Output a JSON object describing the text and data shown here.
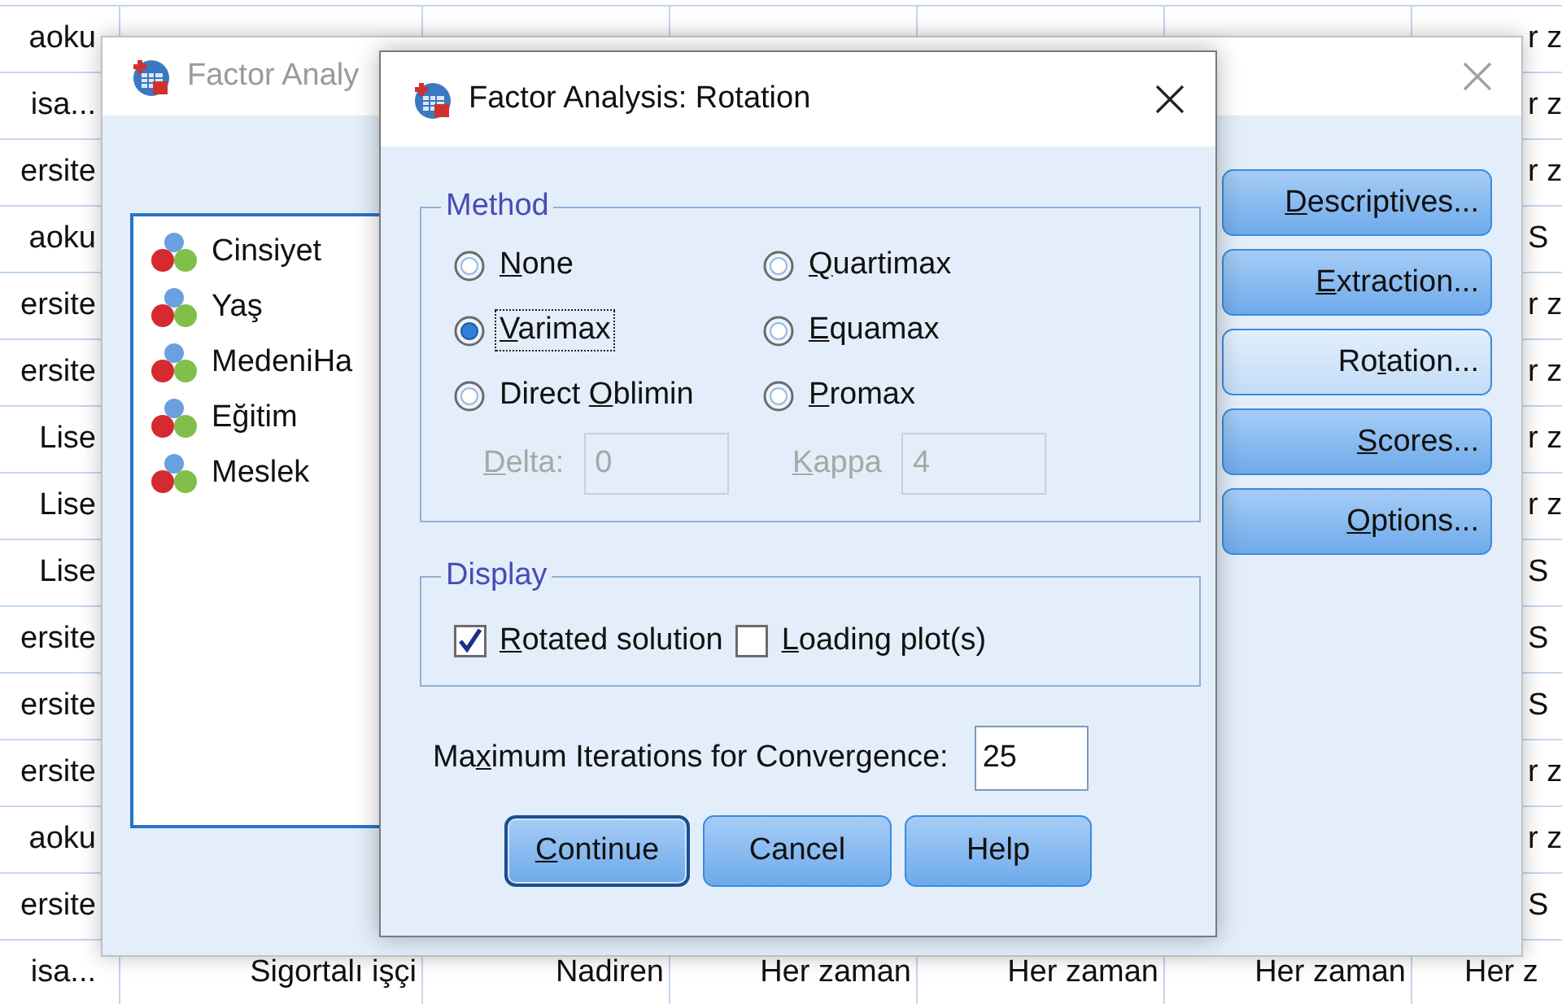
{
  "data_grid": {
    "rows": [
      {
        "kind": "covered",
        "column_1": "aoku",
        "column_7": "r z"
      },
      {
        "kind": "covered",
        "column_1": "isa...",
        "column_7": "r z"
      },
      {
        "kind": "covered",
        "column_1": "ersite",
        "column_7": "r z"
      },
      {
        "kind": "covered",
        "column_1": "aoku",
        "column_7": "S"
      },
      {
        "kind": "covered",
        "column_1": "ersite",
        "column_7": "r z"
      },
      {
        "kind": "covered",
        "column_1": "ersite",
        "column_7": "r z"
      },
      {
        "kind": "covered",
        "column_1": "Lise",
        "column_7": "r z"
      },
      {
        "kind": "covered",
        "column_1": "Lise",
        "column_7": "r z"
      },
      {
        "kind": "covered",
        "column_1": "Lise",
        "column_7": "S"
      },
      {
        "kind": "covered",
        "column_1": "ersite",
        "column_7": "S"
      },
      {
        "kind": "covered",
        "column_1": "ersite",
        "column_7": "S"
      },
      {
        "kind": "covered",
        "column_1": "ersite",
        "column_7": "r z"
      },
      {
        "kind": "covered",
        "column_1": "aoku",
        "column_7": "r z"
      },
      {
        "kind": "covered",
        "column_1": "ersite",
        "column_7": "S"
      },
      {
        "kind": "full",
        "column_1": "isa...",
        "column_2": "Sigortalı işçi",
        "column_3": "Nadiren",
        "column_4": "Her zaman",
        "column_5": "Her zaman",
        "column_6": "Her zaman",
        "column_7": "Her z"
      }
    ]
  },
  "factor_analysis_dialog": {
    "title": "Factor Analy",
    "variables": [
      "Cinsiyet",
      "Yaş",
      "MedeniHa",
      "Eğitim",
      "Meslek"
    ],
    "buttons": [
      {
        "label": [
          {
            "text": "D",
            "underlined": true
          },
          {
            "text": "escriptives...",
            "underlined": false
          }
        ],
        "highlighted": false
      },
      {
        "label": [
          {
            "text": "E",
            "underlined": true
          },
          {
            "text": "xtraction...",
            "underlined": false
          }
        ],
        "highlighted": false
      },
      {
        "label": [
          {
            "text": "Ro",
            "underlined": false
          },
          {
            "text": "t",
            "underlined": true
          },
          {
            "text": "ation...",
            "underlined": false
          }
        ],
        "highlighted": true
      },
      {
        "label": [
          {
            "text": "S",
            "underlined": true
          },
          {
            "text": "cores...",
            "underlined": false
          }
        ],
        "highlighted": false
      },
      {
        "label": [
          {
            "text": "O",
            "underlined": true
          },
          {
            "text": "ptions...",
            "underlined": false
          }
        ],
        "highlighted": false
      }
    ]
  },
  "rotation_dialog": {
    "title": "Factor Analysis: Rotation",
    "method": {
      "legend": "Method",
      "options": [
        {
          "label": [
            {
              "text": "N",
              "underlined": true
            },
            {
              "text": "one",
              "underlined": false
            }
          ],
          "selected": false,
          "focused": false
        },
        {
          "label": [
            {
              "text": "Q",
              "underlined": true
            },
            {
              "text": "uartimax",
              "underlined": false
            }
          ],
          "selected": false,
          "focused": false
        },
        {
          "label": [
            {
              "text": "V",
              "underlined": true
            },
            {
              "text": "arimax",
              "underlined": false
            }
          ],
          "selected": true,
          "focused": true
        },
        {
          "label": [
            {
              "text": "E",
              "underlined": true
            },
            {
              "text": "quamax",
              "underlined": false
            }
          ],
          "selected": false,
          "focused": false
        },
        {
          "label": [
            {
              "text": "Direct ",
              "underlined": false
            },
            {
              "text": "O",
              "underlined": true
            },
            {
              "text": "blimin",
              "underlined": false
            }
          ],
          "selected": false,
          "focused": false
        },
        {
          "label": [
            {
              "text": "P",
              "underlined": true
            },
            {
              "text": "romax",
              "underlined": false
            }
          ],
          "selected": false,
          "focused": false
        }
      ],
      "parameters": [
        {
          "label": [
            {
              "text": "D",
              "underlined": true
            },
            {
              "text": "elta:",
              "underlined": false
            }
          ],
          "value": "0",
          "disabled": true
        },
        {
          "label": [
            {
              "text": "K",
              "underlined": true
            },
            {
              "text": "appa",
              "underlined": false
            }
          ],
          "value": "4",
          "disabled": true
        }
      ]
    },
    "display": {
      "legend": "Display",
      "options": [
        {
          "label": [
            {
              "text": "R",
              "underlined": true
            },
            {
              "text": "otated solution",
              "underlined": false
            }
          ],
          "checked": true
        },
        {
          "label": [
            {
              "text": "L",
              "underlined": true
            },
            {
              "text": "oading plot(s)",
              "underlined": false
            }
          ],
          "checked": false
        }
      ]
    },
    "max_iterations": {
      "label": [
        {
          "text": "Ma",
          "underlined": false
        },
        {
          "text": "x",
          "underlined": true
        },
        {
          "text": "imum Iterations for Convergence:",
          "underlined": false
        }
      ],
      "value": "25"
    },
    "buttons": [
      {
        "label": [
          {
            "text": "C",
            "underlined": true
          },
          {
            "text": "ontinue",
            "underlined": false
          }
        ],
        "default": true
      },
      {
        "label": [
          {
            "text": "Cancel",
            "underlined": false
          }
        ],
        "default": false
      },
      {
        "label": [
          {
            "text": "Help",
            "underlined": false
          }
        ],
        "default": false
      }
    ]
  }
}
